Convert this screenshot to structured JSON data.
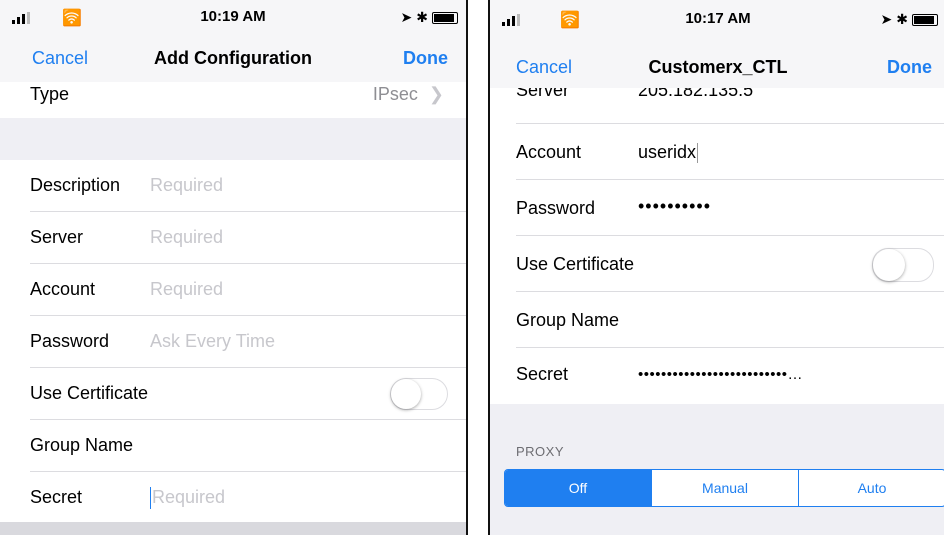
{
  "left": {
    "time": "10:19 AM",
    "nav": {
      "cancel": "Cancel",
      "title": "Add Configuration",
      "done": "Done"
    },
    "type": {
      "label": "Type",
      "value": "IPsec"
    },
    "fields": [
      {
        "label": "Description",
        "placeholder": "Required"
      },
      {
        "label": "Server",
        "placeholder": "Required"
      },
      {
        "label": "Account",
        "placeholder": "Required"
      },
      {
        "label": "Password",
        "placeholder": "Ask Every Time"
      }
    ],
    "use_certificate": {
      "label": "Use Certificate",
      "on": false
    },
    "group_name": {
      "label": "Group Name"
    },
    "secret": {
      "label": "Secret",
      "placeholder": "Required"
    }
  },
  "right": {
    "time": "10:17 AM",
    "nav": {
      "cancel": "Cancel",
      "title": "Customerx_CTL",
      "done": "Done"
    },
    "server": {
      "label": "Server",
      "value": "205.182.135.5"
    },
    "account": {
      "label": "Account",
      "value": "useridx"
    },
    "password": {
      "label": "Password",
      "value": "••••••••••"
    },
    "use_certificate": {
      "label": "Use Certificate",
      "on": false
    },
    "group_name": {
      "label": "Group Name"
    },
    "secret": {
      "label": "Secret",
      "value": "••••••••••••••••••••••••••…"
    },
    "proxy": {
      "header": "PROXY",
      "options": [
        "Off",
        "Manual",
        "Auto"
      ],
      "selected": "Off"
    }
  },
  "colors": {
    "accent": "#1f7ff0",
    "group_bg": "#efeff4",
    "placeholder": "#c7c7cc"
  }
}
